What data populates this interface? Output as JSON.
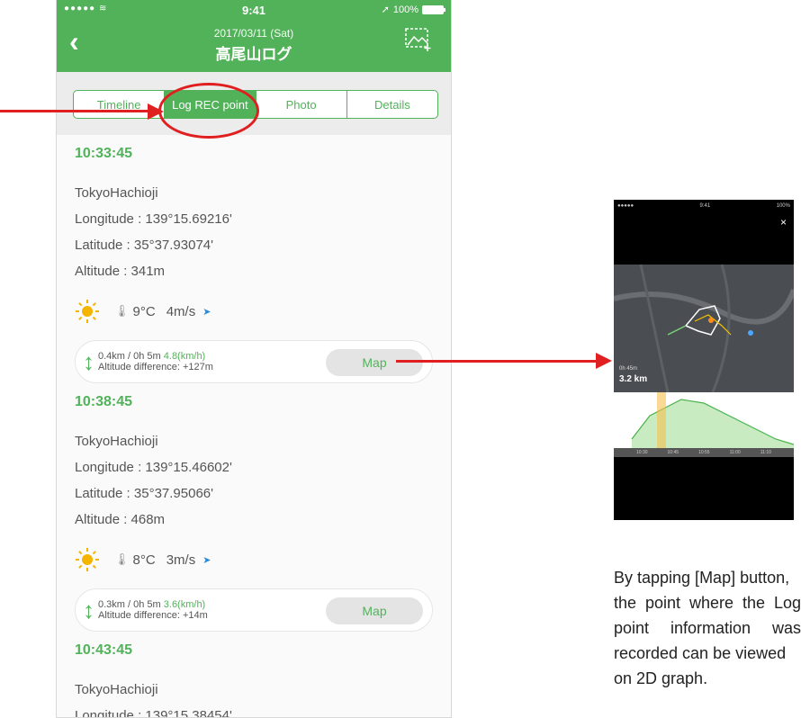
{
  "status": {
    "signal": "●●●●● ≋",
    "time": "9:41",
    "battery": "100%"
  },
  "header": {
    "date": "2017/03/11 (Sat)",
    "title": "高尾山ログ"
  },
  "tabs": [
    "Timeline",
    "Log REC point",
    "Photo",
    "Details"
  ],
  "active_tab": 1,
  "entries": [
    {
      "time": "10:33:45",
      "location": "TokyoHachioji",
      "longitude": "Longitude : 139°15.69216'",
      "latitude": "Latitude : 35°37.93074'",
      "altitude": "Altitude : 341m",
      "temp": "9°C",
      "wind": "4m/s",
      "dist": "0.4km / 0h 5m",
      "speed": "4.8(km/h)",
      "altdiff": "Altitude difference: +127m",
      "map": "Map"
    },
    {
      "time": "10:38:45",
      "location": "TokyoHachioji",
      "longitude": "Longitude : 139°15.46602'",
      "latitude": "Latitude : 35°37.95066'",
      "altitude": "Altitude : 468m",
      "temp": "8°C",
      "wind": "3m/s",
      "dist": "0.3km / 0h 5m",
      "speed": "3.6(km/h)",
      "altdiff": "Altitude difference: +14m",
      "map": "Map"
    },
    {
      "time": "10:43:45",
      "location": "TokyoHachioji",
      "longitude": "Longitude : 139°15.38454'"
    }
  ],
  "thumbnail": {
    "time": "9:41",
    "battery": "100%",
    "close": "×",
    "duration": "0h 45m",
    "distance": "3.2 km",
    "axis": [
      "10:30",
      "10:45",
      "10:55",
      "11:00",
      "11:10"
    ]
  },
  "caption": [
    "By tapping [Map] button,",
    "the point where the Log",
    "point information was",
    "recorded can be viewed",
    "on 2D graph."
  ],
  "colors": {
    "green": "#52b25a",
    "annotation": "#e02020"
  }
}
